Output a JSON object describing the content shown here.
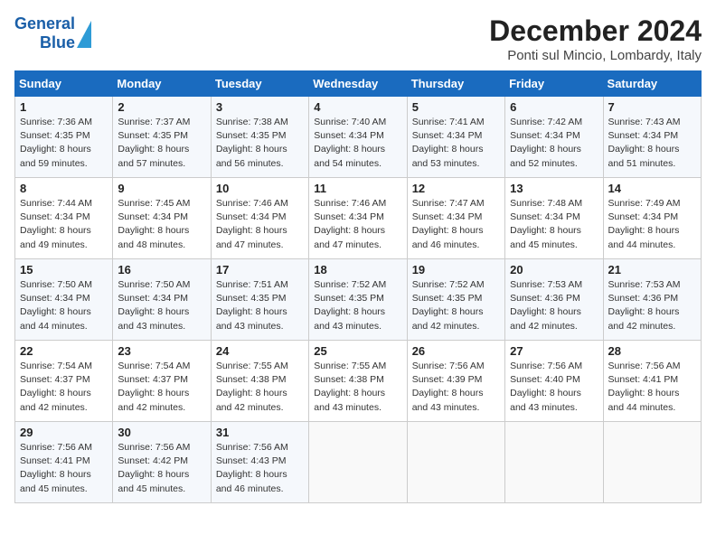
{
  "logo": {
    "line1": "General",
    "line2": "Blue"
  },
  "title": "December 2024",
  "subtitle": "Ponti sul Mincio, Lombardy, Italy",
  "days_of_week": [
    "Sunday",
    "Monday",
    "Tuesday",
    "Wednesday",
    "Thursday",
    "Friday",
    "Saturday"
  ],
  "weeks": [
    [
      {
        "day": 1,
        "info": "Sunrise: 7:36 AM\nSunset: 4:35 PM\nDaylight: 8 hours and 59 minutes."
      },
      {
        "day": 2,
        "info": "Sunrise: 7:37 AM\nSunset: 4:35 PM\nDaylight: 8 hours and 57 minutes."
      },
      {
        "day": 3,
        "info": "Sunrise: 7:38 AM\nSunset: 4:35 PM\nDaylight: 8 hours and 56 minutes."
      },
      {
        "day": 4,
        "info": "Sunrise: 7:40 AM\nSunset: 4:34 PM\nDaylight: 8 hours and 54 minutes."
      },
      {
        "day": 5,
        "info": "Sunrise: 7:41 AM\nSunset: 4:34 PM\nDaylight: 8 hours and 53 minutes."
      },
      {
        "day": 6,
        "info": "Sunrise: 7:42 AM\nSunset: 4:34 PM\nDaylight: 8 hours and 52 minutes."
      },
      {
        "day": 7,
        "info": "Sunrise: 7:43 AM\nSunset: 4:34 PM\nDaylight: 8 hours and 51 minutes."
      }
    ],
    [
      {
        "day": 8,
        "info": "Sunrise: 7:44 AM\nSunset: 4:34 PM\nDaylight: 8 hours and 49 minutes."
      },
      {
        "day": 9,
        "info": "Sunrise: 7:45 AM\nSunset: 4:34 PM\nDaylight: 8 hours and 48 minutes."
      },
      {
        "day": 10,
        "info": "Sunrise: 7:46 AM\nSunset: 4:34 PM\nDaylight: 8 hours and 47 minutes."
      },
      {
        "day": 11,
        "info": "Sunrise: 7:46 AM\nSunset: 4:34 PM\nDaylight: 8 hours and 47 minutes."
      },
      {
        "day": 12,
        "info": "Sunrise: 7:47 AM\nSunset: 4:34 PM\nDaylight: 8 hours and 46 minutes."
      },
      {
        "day": 13,
        "info": "Sunrise: 7:48 AM\nSunset: 4:34 PM\nDaylight: 8 hours and 45 minutes."
      },
      {
        "day": 14,
        "info": "Sunrise: 7:49 AM\nSunset: 4:34 PM\nDaylight: 8 hours and 44 minutes."
      }
    ],
    [
      {
        "day": 15,
        "info": "Sunrise: 7:50 AM\nSunset: 4:34 PM\nDaylight: 8 hours and 44 minutes."
      },
      {
        "day": 16,
        "info": "Sunrise: 7:50 AM\nSunset: 4:34 PM\nDaylight: 8 hours and 43 minutes."
      },
      {
        "day": 17,
        "info": "Sunrise: 7:51 AM\nSunset: 4:35 PM\nDaylight: 8 hours and 43 minutes."
      },
      {
        "day": 18,
        "info": "Sunrise: 7:52 AM\nSunset: 4:35 PM\nDaylight: 8 hours and 43 minutes."
      },
      {
        "day": 19,
        "info": "Sunrise: 7:52 AM\nSunset: 4:35 PM\nDaylight: 8 hours and 42 minutes."
      },
      {
        "day": 20,
        "info": "Sunrise: 7:53 AM\nSunset: 4:36 PM\nDaylight: 8 hours and 42 minutes."
      },
      {
        "day": 21,
        "info": "Sunrise: 7:53 AM\nSunset: 4:36 PM\nDaylight: 8 hours and 42 minutes."
      }
    ],
    [
      {
        "day": 22,
        "info": "Sunrise: 7:54 AM\nSunset: 4:37 PM\nDaylight: 8 hours and 42 minutes."
      },
      {
        "day": 23,
        "info": "Sunrise: 7:54 AM\nSunset: 4:37 PM\nDaylight: 8 hours and 42 minutes."
      },
      {
        "day": 24,
        "info": "Sunrise: 7:55 AM\nSunset: 4:38 PM\nDaylight: 8 hours and 42 minutes."
      },
      {
        "day": 25,
        "info": "Sunrise: 7:55 AM\nSunset: 4:38 PM\nDaylight: 8 hours and 43 minutes."
      },
      {
        "day": 26,
        "info": "Sunrise: 7:56 AM\nSunset: 4:39 PM\nDaylight: 8 hours and 43 minutes."
      },
      {
        "day": 27,
        "info": "Sunrise: 7:56 AM\nSunset: 4:40 PM\nDaylight: 8 hours and 43 minutes."
      },
      {
        "day": 28,
        "info": "Sunrise: 7:56 AM\nSunset: 4:41 PM\nDaylight: 8 hours and 44 minutes."
      }
    ],
    [
      {
        "day": 29,
        "info": "Sunrise: 7:56 AM\nSunset: 4:41 PM\nDaylight: 8 hours and 45 minutes."
      },
      {
        "day": 30,
        "info": "Sunrise: 7:56 AM\nSunset: 4:42 PM\nDaylight: 8 hours and 45 minutes."
      },
      {
        "day": 31,
        "info": "Sunrise: 7:56 AM\nSunset: 4:43 PM\nDaylight: 8 hours and 46 minutes."
      },
      null,
      null,
      null,
      null
    ]
  ]
}
